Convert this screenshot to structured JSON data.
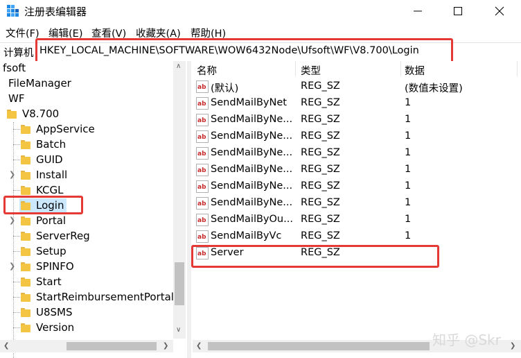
{
  "window": {
    "title": "注册表编辑器"
  },
  "menu": [
    "文件(F)",
    "编辑(E)",
    "查看(V)",
    "收藏夹(A)",
    "帮助(H)"
  ],
  "address": {
    "label": "计算机",
    "path": "HKEY_LOCAL_MACHINE\\SOFTWARE\\WOW6432Node\\Ufsoft\\WF\\V8.700\\Login"
  },
  "tree": {
    "items": [
      {
        "label": "fsoft"
      },
      {
        "label": "FileManager"
      },
      {
        "label": "WF"
      },
      {
        "label": "V8.700"
      },
      {
        "label": "AppService"
      },
      {
        "label": "Batch"
      },
      {
        "label": "GUID"
      },
      {
        "label": "Install"
      },
      {
        "label": "KCGL"
      },
      {
        "label": "Login"
      },
      {
        "label": "Portal"
      },
      {
        "label": "ServerReg"
      },
      {
        "label": "Setup"
      },
      {
        "label": "SPINFO"
      },
      {
        "label": "Start"
      },
      {
        "label": "StartReimbursementPortal"
      },
      {
        "label": "U8SMS"
      },
      {
        "label": "Version"
      }
    ]
  },
  "list": {
    "columns": [
      "名称",
      "类型",
      "数据"
    ],
    "rows": [
      {
        "name": "(默认)",
        "type": "REG_SZ",
        "data": "(数值未设置)"
      },
      {
        "name": "SendMailByNet",
        "type": "REG_SZ",
        "data": "1"
      },
      {
        "name": "SendMailByNe...",
        "type": "REG_SZ",
        "data": "1"
      },
      {
        "name": "SendMailByNe...",
        "type": "REG_SZ",
        "data": "1"
      },
      {
        "name": "SendMailByNe...",
        "type": "REG_SZ",
        "data": "1"
      },
      {
        "name": "SendMailByNe...",
        "type": "REG_SZ",
        "data": "1"
      },
      {
        "name": "SendMailByNe...",
        "type": "REG_SZ",
        "data": "1"
      },
      {
        "name": "SendMailByNe...",
        "type": "REG_SZ",
        "data": "1"
      },
      {
        "name": "SendMailByOu...",
        "type": "REG_SZ",
        "data": "1"
      },
      {
        "name": "SendMailByVc",
        "type": "REG_SZ",
        "data": "1"
      },
      {
        "name": "Server",
        "type": "REG_SZ",
        "data": ""
      }
    ]
  },
  "watermark": "知乎 @Skr",
  "colors": {
    "highlight": "#e53935",
    "selection": "#cce8ff",
    "folder": "#f4c542"
  }
}
